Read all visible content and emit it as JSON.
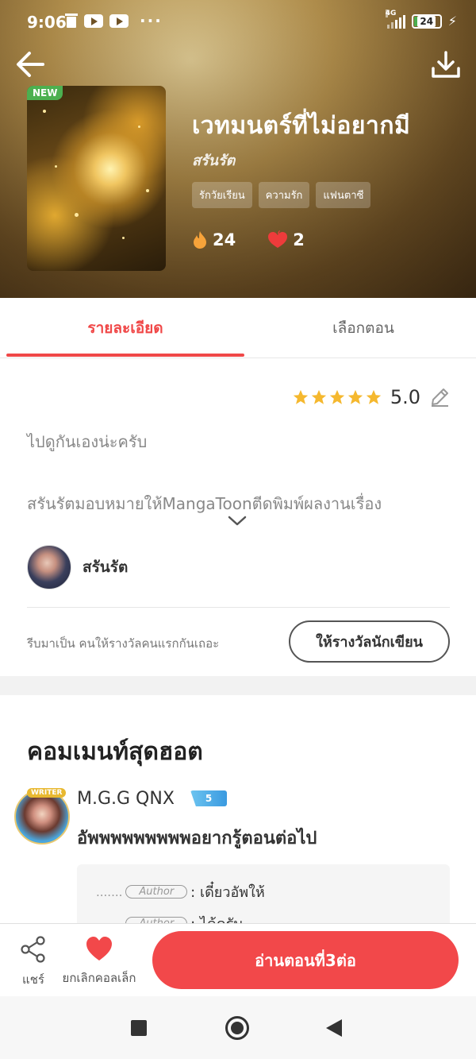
{
  "status_bar": {
    "time": "9:06",
    "network": "4G",
    "battery": "24"
  },
  "hero": {
    "badge": "NEW",
    "title": "เวทมนตร์ที่ไม่อยากมี",
    "author": "สรันรัต",
    "tags": [
      "รักวัยเรียน",
      "ความรัก",
      "แฟนตาซี"
    ],
    "fire_count": "24",
    "heart_count": "2"
  },
  "tabs": {
    "details": "รายละเอียด",
    "episodes": "เลือกตอน"
  },
  "details": {
    "rating": 5,
    "rating_text": "5.0",
    "description": "ไปดูกันเองน่ะครับ",
    "summary": "สรันรัตมอบหมายให้MangaToonตีดพิมพ์ผลงานเรื่อง",
    "author_name": "สรันรัต",
    "reward_prompt": "รีบมาเป็น คนให้รางวัลคนแรกกันเถอะ",
    "reward_button": "ให้รางวัลนักเขียน"
  },
  "comments": {
    "title": "คอมเมนท์สุดฮอต",
    "items": [
      {
        "badge": "WRITER",
        "name": "M.G.G QNX",
        "level": "5",
        "text": "อัพพพพพพพพพอยากรู้ตอนต่อไป",
        "replies": [
          {
            "prefix": ".......",
            "pill": "Author",
            "text": ": เดี๋ยวอัพให้"
          },
          {
            "prefix": ".......",
            "pill": "Author",
            "text": ": ได้ครับ"
          }
        ]
      }
    ]
  },
  "action_bar": {
    "share_label": "แชร์",
    "favorite_label": "ยกเลิกคอลเล็ก",
    "read_button": "อ่านตอนที่3ต่อ"
  },
  "colors": {
    "accent": "#f2484a",
    "tab_active": "#f04848",
    "star": "#f5b82e",
    "new_badge": "#4cb050"
  },
  "icons": {
    "back": "back-arrow-icon",
    "download": "download-icon",
    "fire": "fire-icon",
    "heart": "flame-heart-icon",
    "edit": "pencil-icon",
    "share": "share-icon",
    "favorite": "heart-icon"
  }
}
